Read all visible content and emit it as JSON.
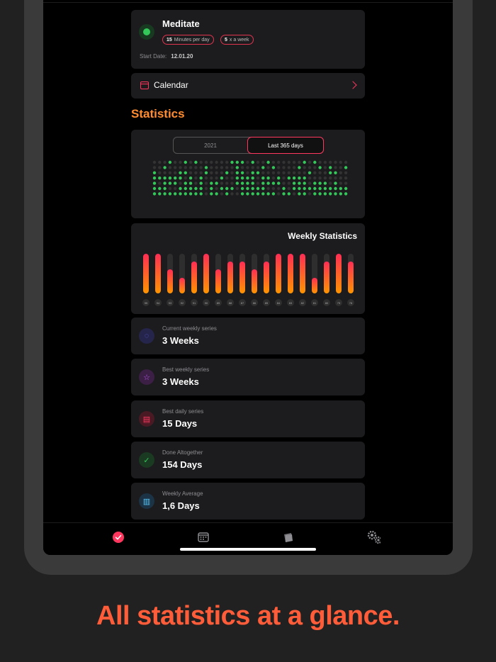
{
  "habit": {
    "title": "Meditate",
    "pill1_value": "15",
    "pill1_text": "Minutes per day",
    "pill2_value": "5",
    "pill2_text": "x a week",
    "start_label": "Start Date:",
    "start_value": "12.01.20",
    "icon": "leaf-icon",
    "icon_color": "#34c759"
  },
  "calendar": {
    "label": "Calendar"
  },
  "statistics": {
    "title": "Statistics",
    "segments": [
      "2021",
      "Last 365 days"
    ],
    "selected_segment": "Last 365 days",
    "dot_colors": {
      "done": "#34c759",
      "empty": "#333333"
    }
  },
  "weekly": {
    "title": "Weekly Statistics",
    "bars": [
      {
        "label": "95",
        "value": 1.0
      },
      {
        "label": "94",
        "value": 1.0
      },
      {
        "label": "93",
        "value": 0.6
      },
      {
        "label": "92",
        "value": 0.4
      },
      {
        "label": "91",
        "value": 0.8
      },
      {
        "label": "90",
        "value": 1.0
      },
      {
        "label": "89",
        "value": 0.6
      },
      {
        "label": "88",
        "value": 0.8
      },
      {
        "label": "87",
        "value": 0.8
      },
      {
        "label": "86",
        "value": 0.6
      },
      {
        "label": "85",
        "value": 0.8
      },
      {
        "label": "84",
        "value": 1.0
      },
      {
        "label": "83",
        "value": 1.0
      },
      {
        "label": "82",
        "value": 1.0
      },
      {
        "label": "81",
        "value": 0.4
      },
      {
        "label": "80",
        "value": 0.8
      },
      {
        "label": "79",
        "value": 1.0
      },
      {
        "label": "78",
        "value": 0.8
      }
    ]
  },
  "stats": [
    {
      "label": "Current weekly series",
      "value": "3 Weeks",
      "icon": "circle-icon",
      "icon_char": "◌",
      "icon_bg": "#25244a",
      "icon_color": "#5e5ce6"
    },
    {
      "label": "Best weekly series",
      "value": "3 Weeks",
      "icon": "star-icon",
      "icon_char": "☆",
      "icon_bg": "#3b1f45",
      "icon_color": "#bf5af2"
    },
    {
      "label": "Best daily series",
      "value": "15 Days",
      "icon": "list-icon",
      "icon_char": "▤",
      "icon_bg": "#4a1a24",
      "icon_color": "#ff375f"
    },
    {
      "label": "Done Altogether",
      "value": "154 Days",
      "icon": "checkmark-circle-icon",
      "icon_char": "✓",
      "icon_bg": "#1a3a22",
      "icon_color": "#34c759"
    },
    {
      "label": "Weekly Average",
      "value": "1,6 Days",
      "icon": "bar-chart-icon",
      "icon_char": "▥",
      "icon_bg": "#1b3344",
      "icon_color": "#5ac8fa"
    }
  ],
  "tabs": [
    {
      "name": "tab-habits",
      "icon": "checkmark-icon",
      "active": true
    },
    {
      "name": "tab-calendar",
      "icon": "calendar-icon",
      "active": false
    },
    {
      "name": "tab-archive",
      "icon": "archive-icon",
      "active": false
    },
    {
      "name": "tab-settings",
      "icon": "gears-icon",
      "active": false
    }
  ],
  "tagline": "All statistics at a glance.",
  "colors": {
    "accent": "#ff375f",
    "orange": "#ff8c2e",
    "card": "#1c1c1e",
    "background": "#212121"
  }
}
